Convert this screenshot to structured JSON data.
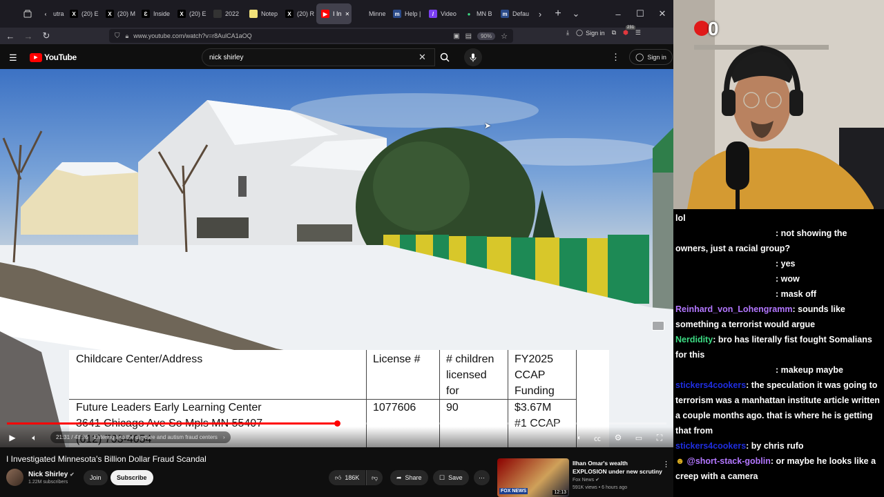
{
  "browser": {
    "tabs": [
      {
        "label": "utra",
        "icon": "arrow-left-icon",
        "fav_bg": "#1c1b22",
        "fav_fg": "#ddd",
        "fav_text": "‹"
      },
      {
        "label": "(20) E",
        "icon": "x-logo-icon",
        "fav_bg": "#000",
        "fav_fg": "#fff",
        "fav_text": "X"
      },
      {
        "label": "(20) M",
        "icon": "x-logo-icon",
        "fav_bg": "#000",
        "fav_fg": "#fff",
        "fav_text": "X"
      },
      {
        "label": "Inside",
        "icon": "substack-icon",
        "fav_bg": "#000",
        "fav_fg": "#fff",
        "fav_text": "Ɛ"
      },
      {
        "label": "(20) E",
        "icon": "x-logo-icon",
        "fav_bg": "#000",
        "fav_fg": "#fff",
        "fav_text": "X"
      },
      {
        "label": "2022",
        "icon": "document-icon",
        "fav_bg": "#333",
        "fav_fg": "#ccc",
        "fav_text": ""
      },
      {
        "label": "Notep",
        "icon": "notepad-icon",
        "fav_bg": "#f2e27a",
        "fav_fg": "#333",
        "fav_text": ""
      },
      {
        "label": "(20) R",
        "icon": "x-logo-icon",
        "fav_bg": "#000",
        "fav_fg": "#fff",
        "fav_text": "X"
      },
      {
        "label": "I In",
        "icon": "youtube-icon",
        "fav_bg": "#ff0000",
        "fav_fg": "#fff",
        "fav_text": "▶",
        "active": true
      },
      {
        "label": "Minne",
        "icon": "tab-icon",
        "fav_bg": "#1c1b22",
        "fav_fg": "#ccc",
        "fav_text": ""
      },
      {
        "label": "Help |",
        "icon": "mn-icon",
        "fav_bg": "#2b4b8a",
        "fav_fg": "#fff",
        "fav_text": "m"
      },
      {
        "label": "Video",
        "icon": "video-tool-icon",
        "fav_bg": "#7b3ff2",
        "fav_fg": "#fff",
        "fav_text": "/"
      },
      {
        "label": "MN B",
        "icon": "maps-pin-icon",
        "fav_bg": "#1c1b22",
        "fav_fg": "#3ddc84",
        "fav_text": "●"
      },
      {
        "label": "Defau",
        "icon": "mn-icon",
        "fav_bg": "#2b4b8a",
        "fav_fg": "#fff",
        "fav_text": "m"
      }
    ],
    "url": "www.youtube.com/watch?v=r8AulCA1aOQ",
    "zoom": "90%",
    "signin": "Sign in",
    "badge_count": "231"
  },
  "youtube": {
    "logo": "YouTube",
    "search_value": "nick shirley",
    "signin": "Sign in"
  },
  "video": {
    "table_headers": [
      "Childcare Center/Address",
      "License #",
      "# children\nlicensed\nfor",
      "FY2025\nCCAP\nFunding"
    ],
    "row": [
      "Future Leaders Early Learning Center\n3641 Chicago Ave So Mpls MN 55407\n(612) 703-4054",
      "1077606",
      "90",
      "$3.67M\n#1 CCAP"
    ],
    "time": "21:31 / 48:26",
    "chapter": "Entering into the daycare and autism fraud centers",
    "progress": 0.5
  },
  "meta": {
    "title": "I Investigated Minnesota's Billion Dollar Fraud Scandal",
    "channel": "Nick Shirley",
    "subscribers": "1.22M subscribers",
    "join": "Join",
    "subscribe": "Subscribe",
    "likes": "186K",
    "share": "Share",
    "save": "Save"
  },
  "recommended": {
    "title": "Ilhan Omar's wealth EXPLOSION under new scrutiny",
    "channel": "Fox News",
    "meta": "591K views • 6 hours ago",
    "duration": "12:13",
    "thumb_label": "FOX NEWS"
  },
  "stream": {
    "overlay_number": "0",
    "chat": [
      {
        "user": "",
        "color": "#ffffff",
        "text": "lol"
      },
      {
        "user": "",
        "color": "#ffffff",
        "text": ": not showing the owners, just a racial group?",
        "indent": true
      },
      {
        "user": "",
        "color": "#ffffff",
        "text": ": yes",
        "indent": true
      },
      {
        "user": "",
        "color": "#ffffff",
        "text": ": wow",
        "indent": true
      },
      {
        "user": "",
        "color": "#ffffff",
        "text": ": mask off",
        "indent": true
      },
      {
        "user": "Reinhard_von_Lohengramm",
        "color": "#b377ff",
        "text": ": sounds like something a terrorist would argue"
      },
      {
        "user": "Nerdidity",
        "color": "#3ddc84",
        "text": ": bro has literally fist fought Somalians for this"
      },
      {
        "user": "",
        "color": "#ffffff",
        "text": ": makeup maybe",
        "indent": true
      },
      {
        "user": "stickers4cookers",
        "color": "#1f2ee0",
        "text": ": the speculation it was going to terrorism was a manhattan institute article written a couple months ago. that is where he is getting that from"
      },
      {
        "user": "stickers4cookers",
        "color": "#1f2ee0",
        "text": ": by chris rufo"
      },
      {
        "user": "@short-stack-goblin",
        "color": "#b377ff",
        "text": ": or maybe he looks like a creep with a camera",
        "badge": true
      }
    ]
  }
}
